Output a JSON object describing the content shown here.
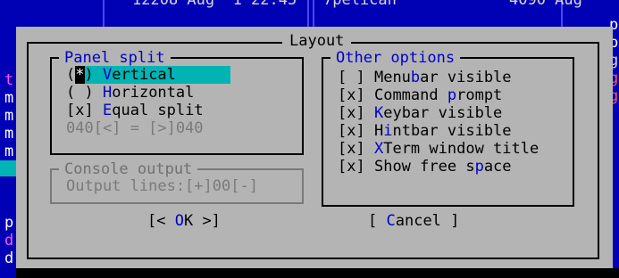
{
  "background": {
    "header_left": "12208 Aug  1 22:45",
    "header_right": "7pelican",
    "header_far": "4090 Aug",
    "left_letters": [
      "t",
      "m",
      "m",
      "m",
      "m",
      "p",
      "d",
      "d"
    ],
    "right_letters": [
      "p",
      "p",
      "g",
      "g",
      "g"
    ]
  },
  "dialog": {
    "title": "Layout",
    "panel_split": {
      "title": "Panel split",
      "options": [
        {
          "mark_open": "(",
          "mark": "*",
          "mark_close": ")",
          "pre": " ",
          "hot": "V",
          "rest": "ertical",
          "selected": true
        },
        {
          "mark_open": "(",
          "mark": " ",
          "mark_close": ")",
          "pre": " ",
          "hot": "H",
          "rest": "orizontal",
          "selected": false
        },
        {
          "mark_open": "[",
          "mark": "x",
          "mark_close": "]",
          "pre": " ",
          "hot": "E",
          "rest": "qual split",
          "selected": false
        }
      ],
      "ratio": "040[<] = [>]040"
    },
    "console_output": {
      "title": "Console output",
      "lines": "Output lines:[+]00[-]"
    },
    "other_options": {
      "title": "Other options",
      "items": [
        {
          "check": "[ ]",
          "pre": "Menu",
          "hot": "b",
          "post": "ar visible"
        },
        {
          "check": "[x]",
          "pre": "Command ",
          "hot": "p",
          "post": "rompt"
        },
        {
          "check": "[x]",
          "pre": "",
          "hot": "K",
          "post": "eybar visible"
        },
        {
          "check": "[x]",
          "pre": "H",
          "hot": "i",
          "post": "ntbar visible"
        },
        {
          "check": "[x]",
          "pre": "",
          "hot": "X",
          "post": "Term window title"
        },
        {
          "check": "[x]",
          "pre": "Show free s",
          "hot": "p",
          "post": "ace"
        }
      ]
    },
    "buttons": {
      "ok": {
        "pre": "[< ",
        "hot": "O",
        "post": "K >]"
      },
      "cancel": {
        "pre": "[ ",
        "hot": "C",
        "post": "ancel ]"
      }
    }
  },
  "colors": {
    "background": "#0000b4",
    "dialog": "#b4b4b4",
    "selection": "#00b4b4",
    "hotkey": "#0000c8"
  }
}
